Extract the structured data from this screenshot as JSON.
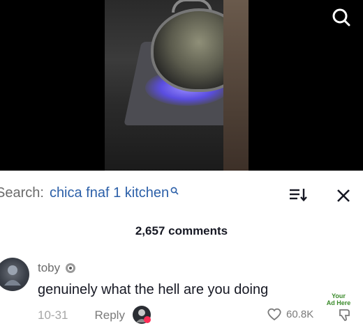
{
  "video": {
    "search_icon": "search-icon"
  },
  "search_bar": {
    "prefix": "Search:",
    "query": "chica fnaf 1 kitchen",
    "search_icon": "search-icon"
  },
  "header": {
    "sort_icon": "sort-icon",
    "close_icon": "close-icon"
  },
  "comments_count": "2,657 comments",
  "comment": {
    "username": "toby",
    "text": "genuinely what the hell are you doing",
    "date": "10-31",
    "reply_label": "Reply",
    "like_count": "60.8K",
    "like_icon": "heart-outline-icon",
    "dislike_icon": "dislike-icon"
  },
  "watermark": {
    "line1": "Your",
    "line2": "Ad Here"
  },
  "colors": {
    "query_link": "#2b5fa8",
    "text_primary": "#161823",
    "text_secondary": "#8a8a8a",
    "heart_badge": "#fe2c55",
    "watermark": "#3a8a2a"
  }
}
